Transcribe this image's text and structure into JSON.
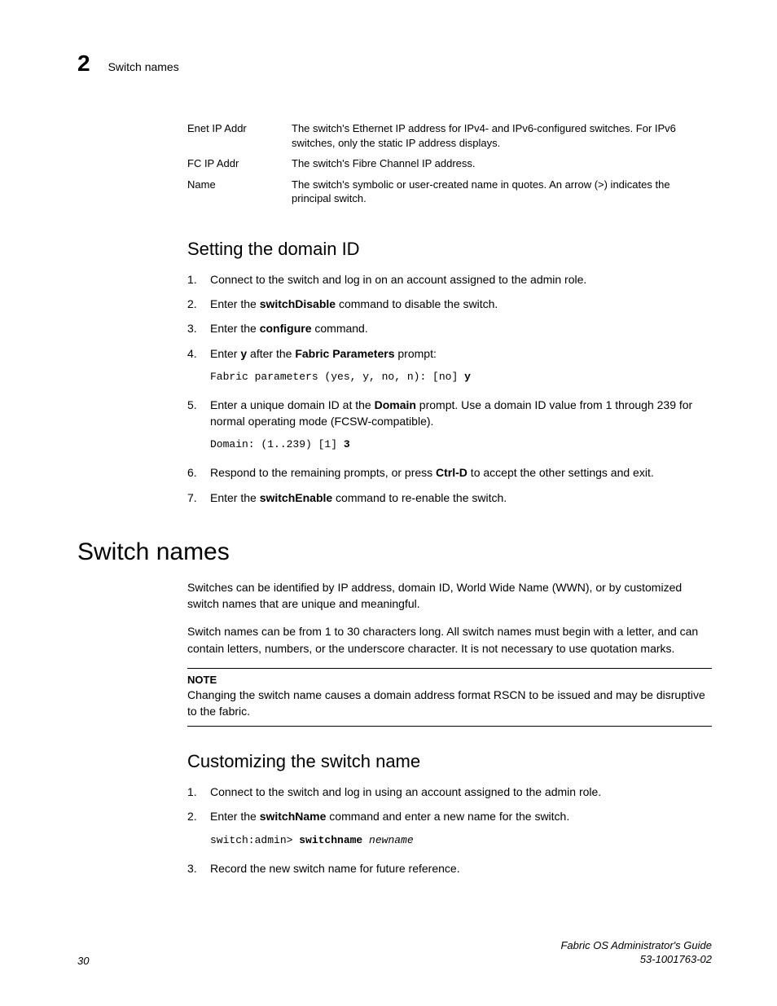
{
  "header": {
    "chapter_number": "2",
    "section": "Switch names"
  },
  "def_rows": [
    {
      "term": "Enet IP Addr",
      "desc": "The switch's Ethernet IP address for IPv4- and IPv6-configured switches. For IPv6 switches, only the static IP address displays."
    },
    {
      "term": "FC IP Addr",
      "desc": "The switch's Fibre Channel IP address."
    },
    {
      "term": "Name",
      "desc": "The switch's symbolic or user-created name in quotes. An arrow (>) indicates the principal switch."
    }
  ],
  "section1": {
    "title": "Setting the domain ID",
    "steps": {
      "s1": "Connect to the switch and log in on an account assigned to the admin role.",
      "s2_pre": "Enter the ",
      "s2_cmd": "switchDisable",
      "s2_post": " command to disable the switch.",
      "s3_pre": "Enter the ",
      "s3_cmd": "configure",
      "s3_post": " command.",
      "s4_pre": "Enter ",
      "s4_y": "y",
      "s4_mid": " after the ",
      "s4_fab": "Fabric Parameters",
      "s4_post": " prompt:",
      "s4_code_plain": "Fabric parameters (yes, y, no, n): [no] ",
      "s4_code_bold": "y",
      "s5_pre": "Enter a unique domain ID at the ",
      "s5_dom": "Domain",
      "s5_post": " prompt. Use a domain ID value from 1 through 239 for normal operating mode (FCSW-compatible).",
      "s5_code_plain": "Domain: (1..239) [1] ",
      "s5_code_bold": "3",
      "s6_pre": "Respond to the remaining prompts, or press ",
      "s6_ctrl": "Ctrl-D",
      "s6_post": " to accept the other settings and exit.",
      "s7_pre": "Enter the ",
      "s7_cmd": "switchEnable",
      "s7_post": " command to re-enable the switch."
    }
  },
  "chapter_title": "Switch names",
  "intro_p1": "Switches can be identified by IP address, domain ID, World Wide Name (WWN), or by customized switch names that are unique and meaningful.",
  "intro_p2": "Switch names can be from 1 to 30 characters long. All switch names must begin with a letter, and can contain letters, numbers, or the underscore character. It is not necessary to use quotation marks.",
  "note": {
    "label": "NOTE",
    "body": "Changing the switch name causes a domain address format RSCN to be issued and may be disruptive to the fabric."
  },
  "section2": {
    "title": "Customizing the switch name",
    "steps": {
      "s1": "Connect to the switch and log in using an account assigned to the admin role.",
      "s2_pre": "Enter the ",
      "s2_cmd": "switchName ",
      "s2_post": " command and enter a new name for the switch.",
      "s2_code_plain": "switch:admin> ",
      "s2_code_bold": "switchname",
      "s2_code_italic": " newname",
      "s3": "Record the new switch name for future reference."
    }
  },
  "footer": {
    "page": "30",
    "doc_title": "Fabric OS Administrator's Guide",
    "doc_num": "53-1001763-02"
  }
}
